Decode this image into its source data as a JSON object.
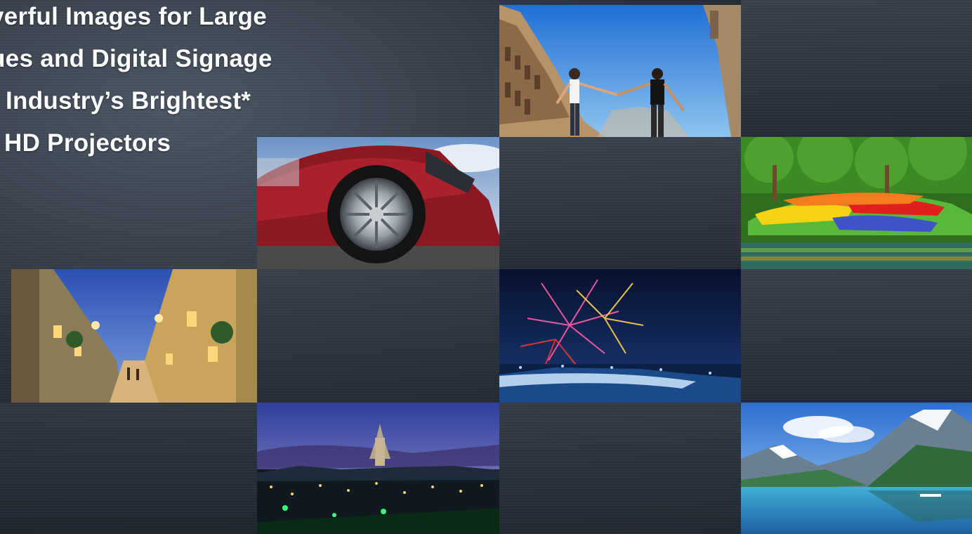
{
  "headline": {
    "lines": [
      "verful Images for Large",
      "ues and Digital Signage",
      "Industry’s Brightest*",
      "HD Projectors"
    ]
  },
  "photos": [
    {
      "name": "couple-venice-photo"
    },
    {
      "name": "red-sports-car-wheel-photo"
    },
    {
      "name": "tulip-garden-photo"
    },
    {
      "name": "old-town-street-night-photo"
    },
    {
      "name": "fireworks-waterfall-photo"
    },
    {
      "name": "city-skyline-dusk-photo"
    },
    {
      "name": "mountain-lake-photo"
    }
  ],
  "colors": {
    "background": "#1c2129",
    "headline_text": "#ffffff"
  }
}
